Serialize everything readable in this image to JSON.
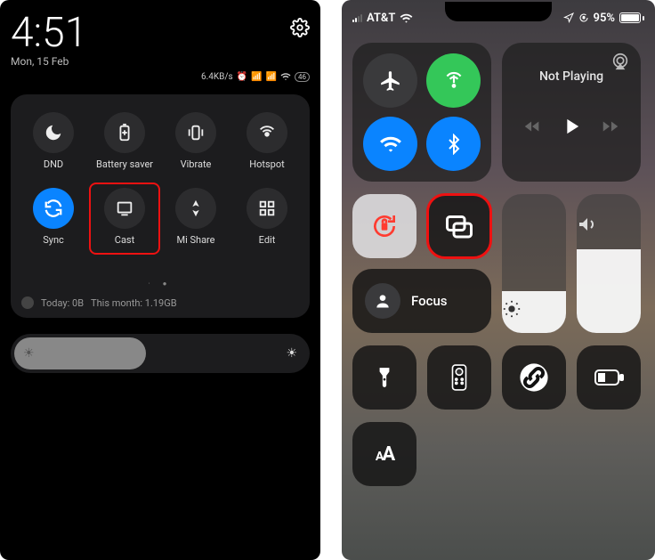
{
  "android": {
    "time": "4:51",
    "date": "Mon, 15 Feb",
    "net_speed": "6.4KB/s",
    "battery_badge": "46",
    "tiles": {
      "dnd": "DND",
      "battery_saver": "Battery saver",
      "vibrate": "Vibrate",
      "hotspot": "Hotspot",
      "sync": "Sync",
      "cast": "Cast",
      "mi_share": "Mi Share",
      "edit": "Edit"
    },
    "page_indicator": "●  ●",
    "usage_today": "Today: 0B",
    "usage_month": "This month: 1.19GB"
  },
  "ios": {
    "carrier": "AT&T",
    "battery_pct": "95%",
    "media_title": "Not Playing",
    "focus_label": "Focus",
    "text_size": "AA",
    "brightness_level": 30,
    "volume_level": 60
  }
}
